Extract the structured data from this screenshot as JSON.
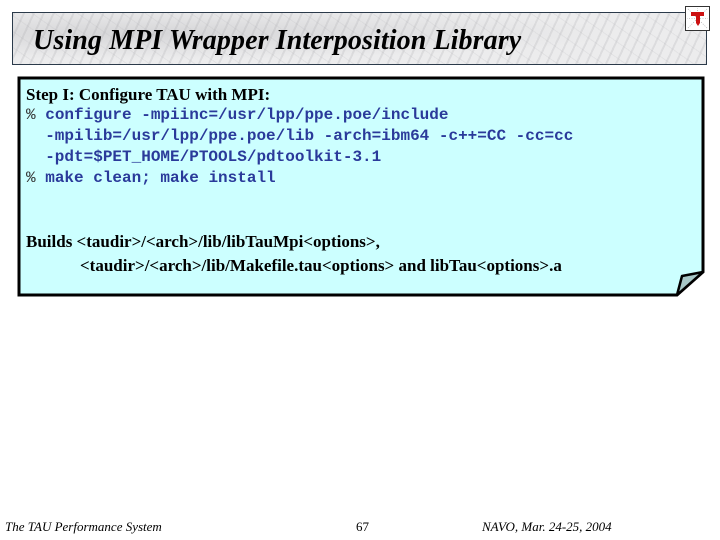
{
  "slide": {
    "title": "Using MPI Wrapper Interposition Library",
    "logo_icon": "tau-pushpin-logo-icon",
    "note": {
      "heading": "Step I: Configure TAU with MPI:",
      "code_lines": [
        {
          "prompt": "%",
          "text": " configure -mpiinc=/usr/lpp/ppe.poe/include"
        },
        {
          "prompt": "",
          "text": "  -mpilib=/usr/lpp/ppe.poe/lib -arch=ibm64 -c++=CC -cc=cc"
        },
        {
          "prompt": "",
          "text": "  -pdt=$PET_HOME/PTOOLS/pdtoolkit-3.1"
        },
        {
          "prompt": "%",
          "text": " make clean; make install"
        }
      ],
      "builds_line1": "Builds <taudir>/<arch>/lib/libTauMpi<options>,",
      "builds_line2": "<taudir>/<arch>/lib/Makefile.tau<options> and libTau<options>.a",
      "background_color": "#ccffff",
      "corner_color": "#a8c8c8"
    },
    "footer": {
      "left": "The TAU Performance System",
      "center": "67",
      "right": "NAVO, Mar. 24-25, 2004"
    }
  }
}
